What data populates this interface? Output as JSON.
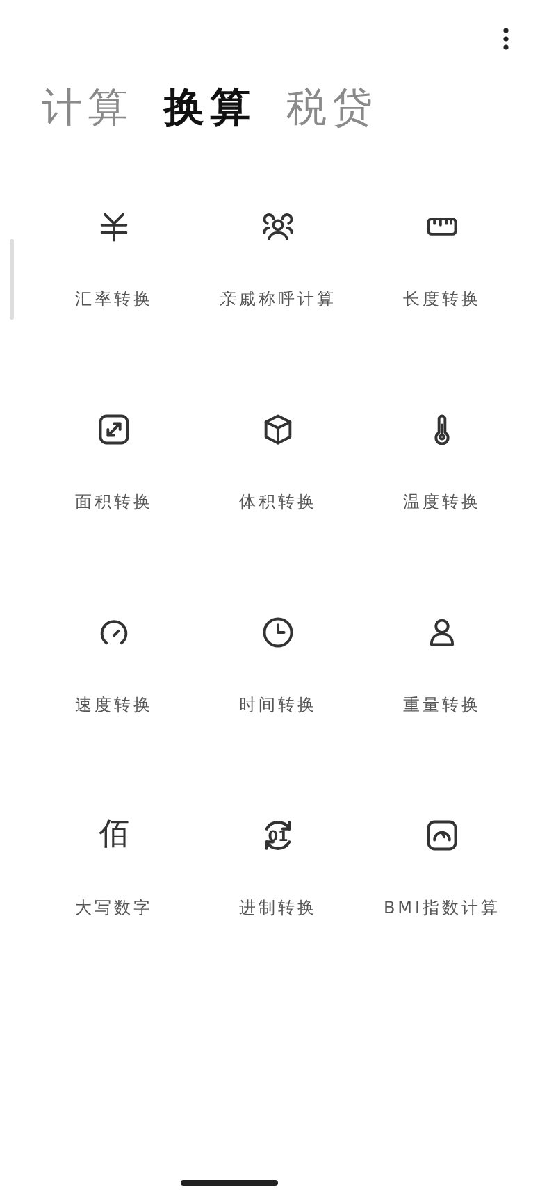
{
  "tabs": [
    {
      "label": "计算",
      "selected": false
    },
    {
      "label": "换算",
      "selected": true
    },
    {
      "label": "税贷",
      "selected": false
    }
  ],
  "tools": [
    {
      "kind": "yen",
      "label": "汇率转换"
    },
    {
      "kind": "people",
      "label": "亲戚称呼计算"
    },
    {
      "kind": "ruler",
      "label": "长度转换"
    },
    {
      "kind": "area",
      "label": "面积转换"
    },
    {
      "kind": "cube",
      "label": "体积转换"
    },
    {
      "kind": "thermometer",
      "label": "温度转换"
    },
    {
      "kind": "gauge",
      "label": "速度转换"
    },
    {
      "kind": "clock",
      "label": "时间转换"
    },
    {
      "kind": "weight",
      "label": "重量转换"
    },
    {
      "kind": "glyph",
      "glyph": "佰",
      "label": "大写数字"
    },
    {
      "kind": "cycle",
      "glyph": "01",
      "label": "进制转换"
    },
    {
      "kind": "bmi",
      "label": "BMI指数计算"
    }
  ]
}
